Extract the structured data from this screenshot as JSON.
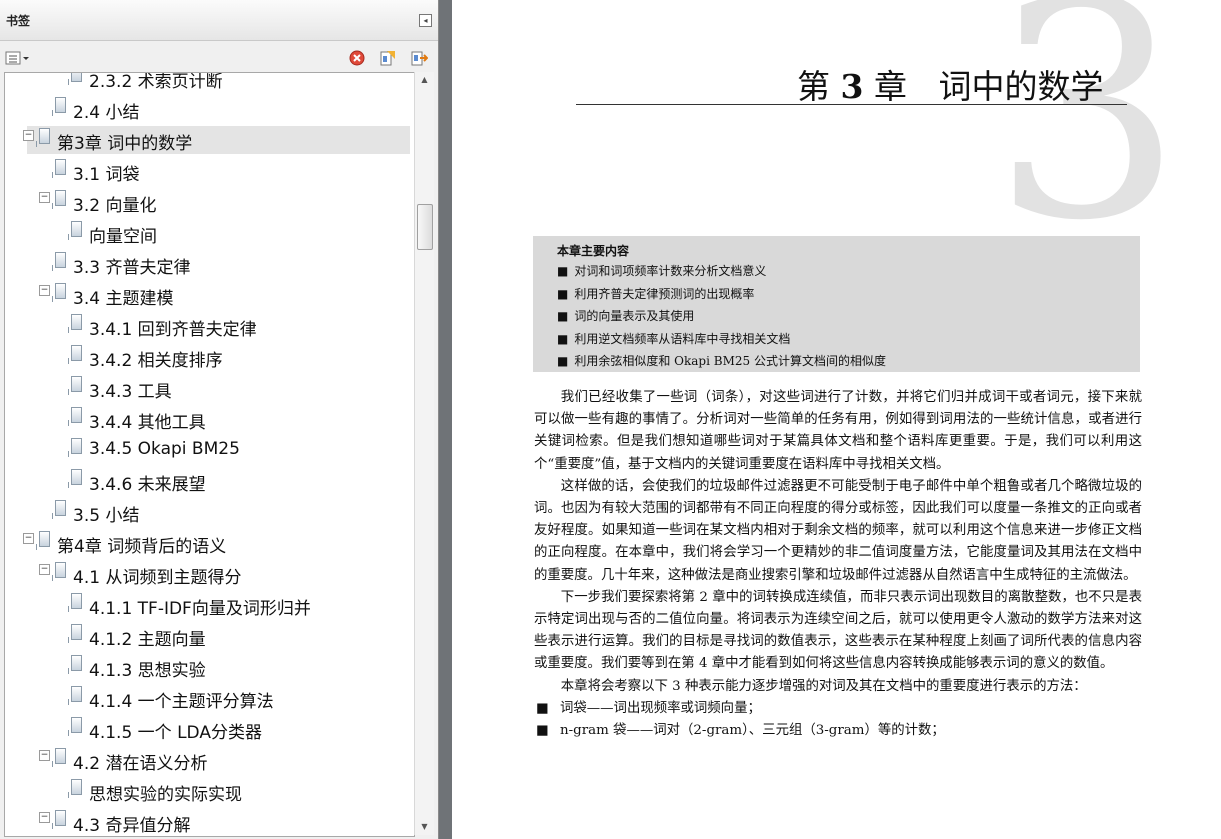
{
  "panel": {
    "title": "书签",
    "tree": [
      {
        "label": "2.3.2  术索页计断",
        "depth": 2,
        "partial": true
      },
      {
        "label": "2.4  小结",
        "depth": 1
      },
      {
        "label": "第3章  词中的数学",
        "depth": 0,
        "selected": true,
        "expanded": true
      },
      {
        "label": "3.1  词袋",
        "depth": 1
      },
      {
        "label": "3.2  向量化",
        "depth": 1,
        "expanded": true
      },
      {
        "label": "向量空间",
        "depth": 2
      },
      {
        "label": "3.3  齐普夫定律",
        "depth": 1
      },
      {
        "label": "3.4  主题建模",
        "depth": 1,
        "expanded": true
      },
      {
        "label": "3.4.1  回到齐普夫定律",
        "depth": 2
      },
      {
        "label": "3.4.2  相关度排序",
        "depth": 2
      },
      {
        "label": "3.4.3  工具",
        "depth": 2
      },
      {
        "label": "3.4.4  其他工具",
        "depth": 2
      },
      {
        "label": "3.4.5  Okapi BM25",
        "depth": 2
      },
      {
        "label": "3.4.6  未来展望",
        "depth": 2
      },
      {
        "label": "3.5  小结",
        "depth": 1
      },
      {
        "label": "第4章  词频背后的语义",
        "depth": 0,
        "expanded": true
      },
      {
        "label": "4.1  从词频到主题得分",
        "depth": 1,
        "expanded": true
      },
      {
        "label": "4.1.1  TF-IDF向量及词形归并",
        "depth": 2
      },
      {
        "label": "4.1.2  主题向量",
        "depth": 2
      },
      {
        "label": "4.1.3  思想实验",
        "depth": 2
      },
      {
        "label": "4.1.4  一个主题评分算法",
        "depth": 2
      },
      {
        "label": "4.1.5  一个 LDA分类器",
        "depth": 2
      },
      {
        "label": "4.2  潜在语义分析",
        "depth": 1,
        "expanded": true
      },
      {
        "label": "思想实验的实际实现",
        "depth": 2
      },
      {
        "label": "4.3  奇异值分解",
        "depth": 1,
        "expanded": true
      }
    ]
  },
  "doc": {
    "big_number": "3",
    "chapter_prefix": "第",
    "chapter_num": "3",
    "chapter_suffix": "章",
    "chapter_title": "词中的数学",
    "box_title": "本章主要内容",
    "box_items": [
      "对词和词项频率计数来分析文档意义",
      "利用齐普夫定律预测词的出现概率",
      "词的向量表示及其使用",
      "利用逆文档频率从语料库中寻找相关文档",
      "利用余弦相似度和 Okapi BM25 公式计算文档间的相似度"
    ],
    "paragraphs": [
      "我们已经收集了一些词（词条），对这些词进行了计数，并将它们归并成词干或者词元，接下来就可以做一些有趣的事情了。分析词对一些简单的任务有用，例如得到词用法的一些统计信息，或者进行关键词检索。但是我们想知道哪些词对于某篇具体文档和整个语料库更重要。于是，我们可以利用这个“重要度”值，基于文档内的关键词重要度在语料库中寻找相关文档。",
      "这样做的话，会使我们的垃圾邮件过滤器更不可能受制于电子邮件中单个粗鲁或者几个略微垃圾的词。也因为有较大范围的词都带有不同正向程度的得分或标签，因此我们可以度量一条推文的正向或者友好程度。如果知道一些词在某文档内相对于剩余文档的频率，就可以利用这个信息来进一步修正文档的正向程度。在本章中，我们将会学习一个更精妙的非二值词度量方法，它能度量词及其用法在文档中的重要度。几十年来，这种做法是商业搜索引擎和垃圾邮件过滤器从自然语言中生成特征的主流做法。",
      "下一步我们要探索将第 2 章中的词转换成连续值，而非只表示词出现数目的离散整数，也不只是表示特定词出现与否的二值位向量。将词表示为连续空间之后，就可以使用更令人激动的数学方法来对这些表示进行运算。我们的目标是寻找词的数值表示，这些表示在某种程度上刻画了词所代表的信息内容或重要度。我们要等到在第 4 章中才能看到如何将这些信息内容转换成能够表示词的意义的数值。",
      "本章将会考察以下 3 种表示能力逐步增强的对词及其在文档中的重要度进行表示的方法："
    ],
    "list_items": [
      "词袋——词出现频率或词频向量；",
      "n-gram 袋——词对（2-gram）、三元组（3-gram）等的计数；"
    ]
  }
}
